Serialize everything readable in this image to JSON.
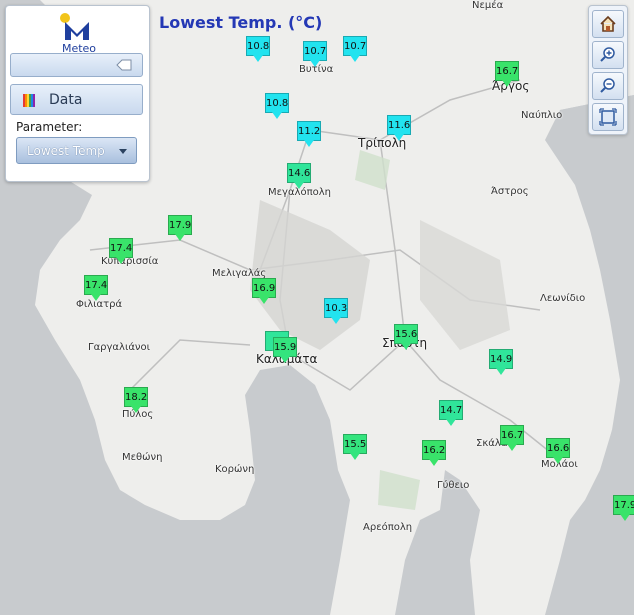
{
  "title": "Lowest Temp. (°C)",
  "panel": {
    "logo_text": "Meteo",
    "data_label": "Data",
    "parameter_label": "Parameter:",
    "parameter_value": "Lowest Temp"
  },
  "colors": {
    "green": "#39e36a",
    "teal": "#22e6c4",
    "cyan": "#22e3ef",
    "sea": "#c4c8cc",
    "land": "#eeeeec"
  },
  "tools": [
    "home-icon",
    "zoom-in-icon",
    "zoom-out-icon",
    "full-extent-icon"
  ],
  "stations": [
    {
      "value": "10.8",
      "color": "#22e3ef"
    },
    {
      "value": "10.7",
      "color": "#22e3ef"
    },
    {
      "value": "10.7",
      "color": "#22e3ef"
    },
    {
      "value": "16.7",
      "color": "#39e36a"
    },
    {
      "value": "10.8",
      "color": "#22e3ef"
    },
    {
      "value": "11.2",
      "color": "#22e3ef"
    },
    {
      "value": "11.6",
      "color": "#22e3ef"
    },
    {
      "value": "14.6",
      "color": "#30e59a"
    },
    {
      "value": "17.9",
      "color": "#39e36a"
    },
    {
      "value": "17.4",
      "color": "#39e36a"
    },
    {
      "value": "17.4",
      "color": "#39e36a"
    },
    {
      "value": "16.9",
      "color": "#39e36a"
    },
    {
      "value": "10.3",
      "color": "#22e3ef"
    },
    {
      "value": "15.6",
      "color": "#34e47e"
    },
    {
      "value": "",
      "color": "#30e59a"
    },
    {
      "value": "15.9",
      "color": "#34e47e"
    },
    {
      "value": "14.9",
      "color": "#30e59a"
    },
    {
      "value": "18.2",
      "color": "#39e36a"
    },
    {
      "value": "14.7",
      "color": "#30e59a"
    },
    {
      "value": "16.7",
      "color": "#39e36a"
    },
    {
      "value": "15.5",
      "color": "#34e47e"
    },
    {
      "value": "16.2",
      "color": "#39e36a"
    },
    {
      "value": "16.6",
      "color": "#39e36a"
    },
    {
      "value": "17.9",
      "color": "#39e36a"
    }
  ],
  "places": [
    "Βυτίνα",
    "Άργος",
    "Ναύπλιο",
    "Τρίπολη",
    "Μεγαλόπολη",
    "Άστρος",
    "Κυπαρισσία",
    "Μελιγαλάς",
    "Φιλιατρά",
    "Λεωνίδιο",
    "Γαργαλιάνοι",
    "Καλαμάτα",
    "Σπάρτη",
    "Πύλος",
    "Σκάλα",
    "Μεθώνη",
    "Κορώνη",
    "Μολάοι",
    "Γύθειο",
    "Αρεόπολη",
    "Νεμέα"
  ]
}
